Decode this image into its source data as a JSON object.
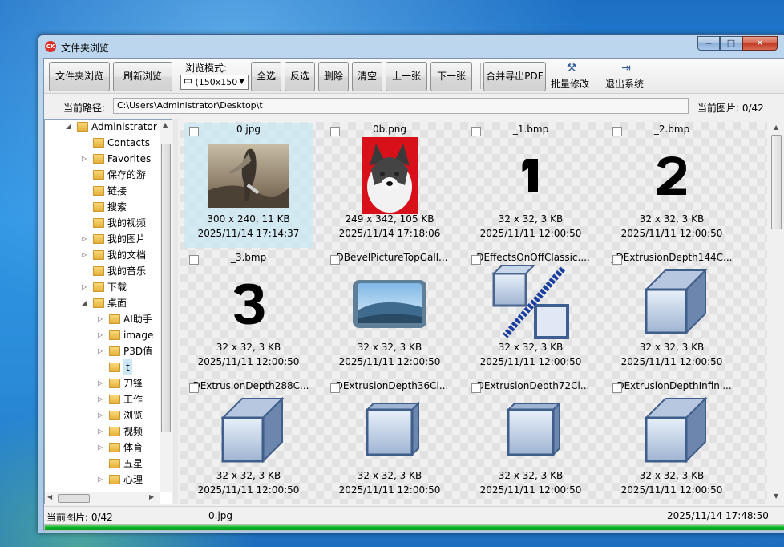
{
  "window": {
    "title": "文件夹浏览",
    "app_icon_text": "CK"
  },
  "toolbar": {
    "browse_folder": "文件夹浏览",
    "refresh": "刷新浏览",
    "mode_label": "浏览模式:",
    "mode_value": "中 (150x150",
    "select_all": "全选",
    "invert": "反选",
    "delete": "删除",
    "clear": "清空",
    "prev": "上一张",
    "next": "下一张",
    "merge_pdf": "合并导出PDF",
    "batch_edit": "批量修改",
    "exit": "退出系统"
  },
  "pathbar": {
    "label": "当前路径:",
    "path": "C:\\Users\\Administrator\\Desktop\\t",
    "count": "当前图片: 0/42"
  },
  "tree": [
    {
      "label": "Administrator",
      "expanded": true
    },
    {
      "label": "Contacts"
    },
    {
      "label": "Favorites"
    },
    {
      "label": "保存的游"
    },
    {
      "label": "链接"
    },
    {
      "label": "搜索"
    },
    {
      "label": "我的视频"
    },
    {
      "label": "我的图片"
    },
    {
      "label": "我的文档"
    },
    {
      "label": "我的音乐"
    },
    {
      "label": "下载"
    },
    {
      "label": "桌面",
      "expanded": true
    },
    {
      "label": "AI助手"
    },
    {
      "label": "image"
    },
    {
      "label": "P3D值"
    },
    {
      "label": "t"
    },
    {
      "label": "刀锋"
    },
    {
      "label": "工作"
    },
    {
      "label": "浏览"
    },
    {
      "label": "视频"
    },
    {
      "label": "体育"
    },
    {
      "label": "五星"
    },
    {
      "label": "心理"
    }
  ],
  "images": [
    {
      "name": "0.jpg",
      "size": "300 x 240, 11 KB",
      "date": "2025/11/14 17:14:37",
      "thumb": "photo-warrior"
    },
    {
      "name": "0b.png",
      "size": "249 x 342, 105 KB",
      "date": "2025/11/14 17:18:06",
      "thumb": "photo-dog"
    },
    {
      "name": "_1.bmp",
      "size": "32 x 32, 3 KB",
      "date": "2025/11/11 12:00:50",
      "thumb": "digit-1"
    },
    {
      "name": "_2.bmp",
      "size": "32 x 32, 3 KB",
      "date": "2025/11/11 12:00:50",
      "thumb": "digit-2"
    },
    {
      "name": "_3.bmp",
      "size": "32 x 32, 3 KB",
      "date": "2025/11/11 12:00:50",
      "thumb": "digit-3"
    },
    {
      "name": "_DBevelPictureTopGall...",
      "size": "32 x 32, 3 KB",
      "date": "2025/11/11 12:00:50",
      "thumb": "bevel-picture"
    },
    {
      "name": "_DEffectsOnOffClassic....",
      "size": "32 x 32, 3 KB",
      "date": "2025/11/11 12:00:50",
      "thumb": "effects-onoff"
    },
    {
      "name": "_DExtrusionDepth144C...",
      "size": "32 x 32, 3 KB",
      "date": "2025/11/11 12:00:50",
      "thumb": "extrusion-cube"
    },
    {
      "name": "_DExtrusionDepth288C...",
      "size": "32 x 32, 3 KB",
      "date": "2025/11/11 12:00:50",
      "thumb": "extrusion-cube"
    },
    {
      "name": "_DExtrusionDepth36Cl...",
      "size": "32 x 32, 3 KB",
      "date": "2025/11/11 12:00:50",
      "thumb": "extrusion-flat"
    },
    {
      "name": "_DExtrusionDepth72Cl...",
      "size": "32 x 32, 3 KB",
      "date": "2025/11/11 12:00:50",
      "thumb": "extrusion-flat"
    },
    {
      "name": "_DExtrusionDepthInfini...",
      "size": "32 x 32, 3 KB",
      "date": "2025/11/11 12:00:50",
      "thumb": "extrusion-cube"
    }
  ],
  "status": {
    "left": "当前图片: 0/42",
    "file": "0.jpg",
    "time": "2025/11/14 17:48:50",
    "progress": 1.0
  },
  "colors": {
    "progress": "#06b025",
    "selection": "#cce8f4",
    "folder": "#e6b13b"
  }
}
